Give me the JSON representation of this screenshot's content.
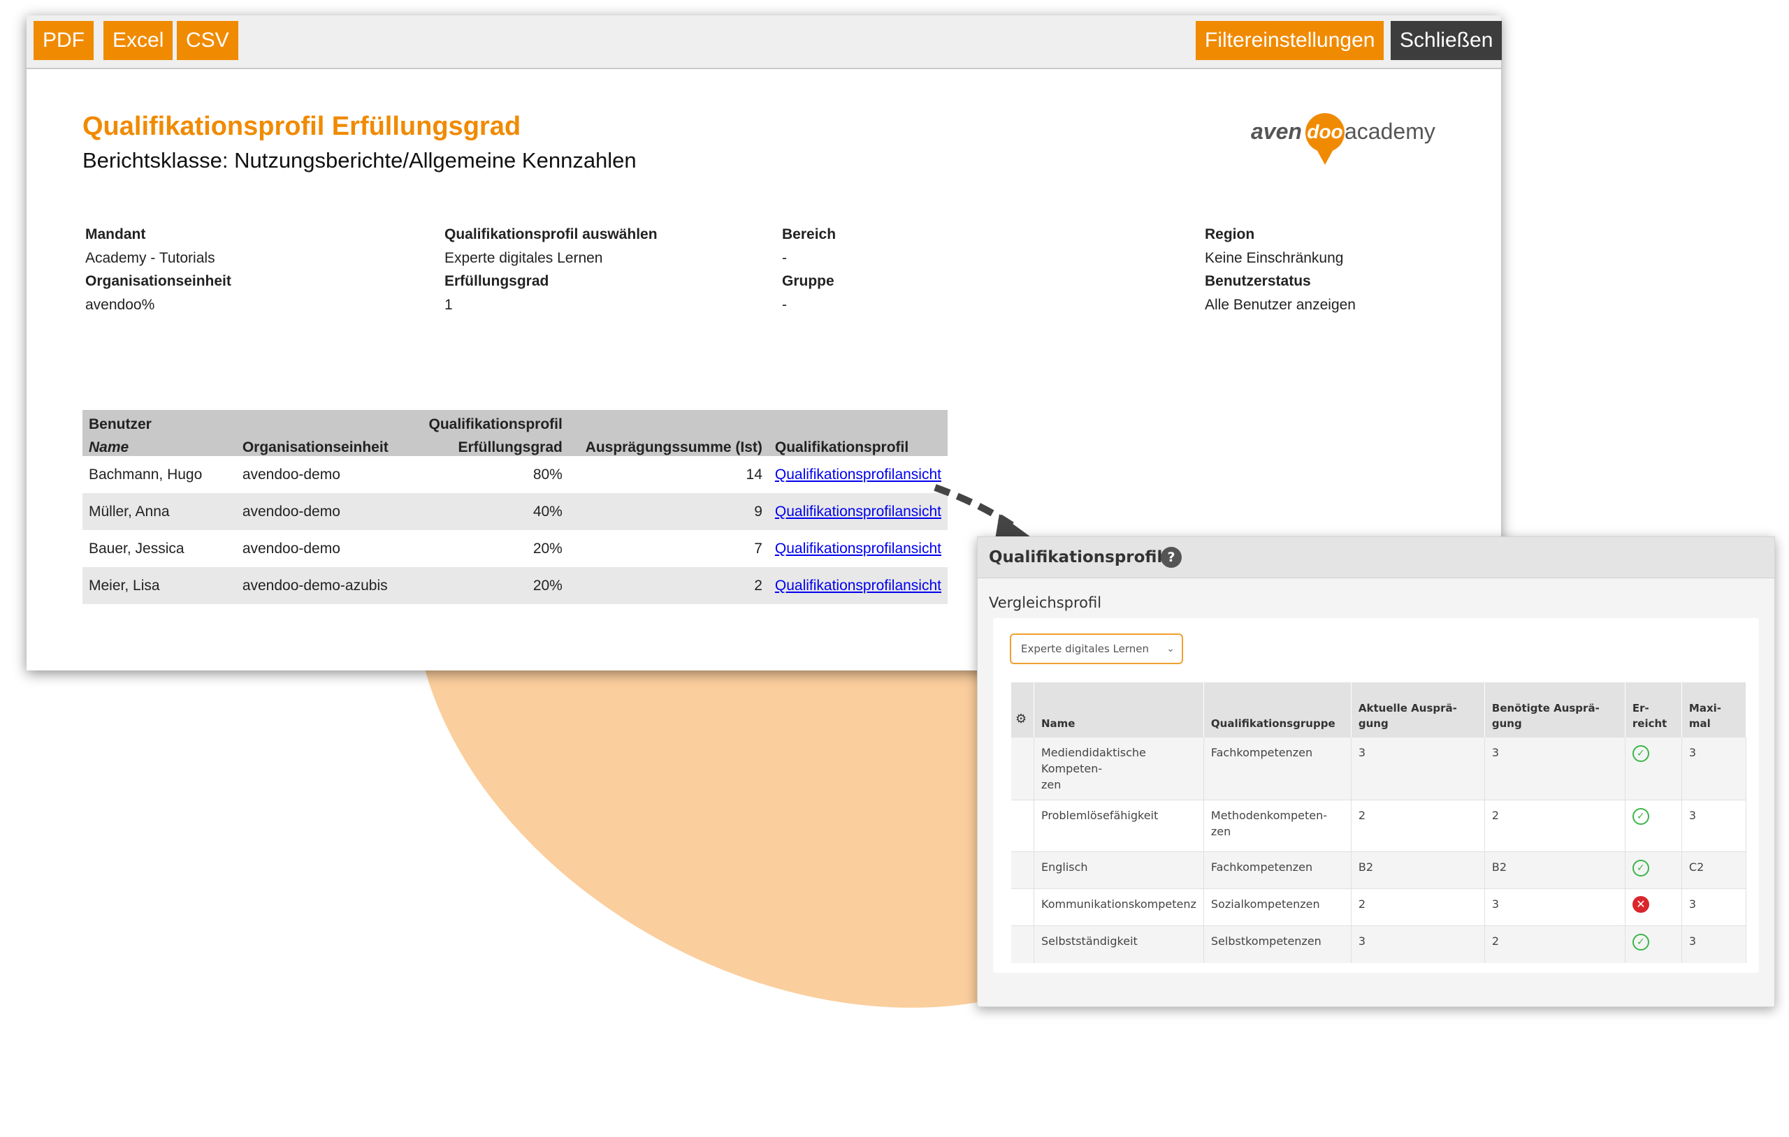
{
  "toolbar": {
    "pdf": "PDF",
    "excel": "Excel",
    "csv": "CSV",
    "filter": "Filtereinstellungen",
    "close": "Schließen"
  },
  "report": {
    "title": "Qualifikationsprofil Erfüllungsgrad",
    "subtitle": "Berichtsklasse: Nutzungsberichte/Allgemeine Kennzahlen",
    "logo": {
      "left": "aven",
      "middle": "doo",
      "right": "academy"
    }
  },
  "filters": {
    "mandant_label": "Mandant",
    "mandant_value": "Academy - Tutorials",
    "orgeinheit_label": "Organisationseinheit",
    "orgeinheit_value": "avendoo%",
    "qprofil_label": "Qualifikationsprofil auswählen",
    "qprofil_value": "Experte digitales Lernen",
    "erfuellung_label": "Erfüllungsgrad",
    "erfuellung_value": "1",
    "bereich_label": "Bereich",
    "bereich_value": "-",
    "gruppe_label": "Gruppe",
    "gruppe_value": "-",
    "region_label": "Region",
    "region_value": "Keine Einschränkung",
    "status_label": "Benutzerstatus",
    "status_value": "Alle Benutzer anzeigen"
  },
  "report_table": {
    "group_benutzer": "Benutzer",
    "group_qprofil": "Qualifikationsprofil",
    "col_name": "Name",
    "col_org": "Organisationseinheit",
    "col_grad": "Erfüllungsgrad",
    "col_summe": "Ausprägungssumme (Ist)",
    "col_profil": "Qualifikationsprofil",
    "rows": [
      {
        "name": "Bachmann, Hugo",
        "org": "avendoo-demo",
        "grad": "80%",
        "summe": "14",
        "link": "Qualifikationsprofilansicht"
      },
      {
        "name": "Müller, Anna",
        "org": "avendoo-demo",
        "grad": "40%",
        "summe": "9",
        "link": "Qualifikationsprofilansicht"
      },
      {
        "name": "Bauer, Jessica",
        "org": "avendoo-demo",
        "grad": "20%",
        "summe": "7",
        "link": "Qualifikationsprofilansicht"
      },
      {
        "name": "Meier, Lisa",
        "org": "avendoo-demo-azubis",
        "grad": "20%",
        "summe": "2",
        "link": "Qualifikationsprofilansicht"
      }
    ]
  },
  "panel": {
    "title": "Qualifikationsprofil",
    "help": "?",
    "vergleich_label": "Vergleichsprofil",
    "select_value": "Experte digitales Lernen",
    "headers": {
      "name": "Name",
      "gruppe": "Qualifikationsgruppe",
      "aktuell_1": "Aktuelle Ausprä-",
      "aktuell_2": "gung",
      "benoetigt_1": "Benötigte Ausprä-",
      "benoetigt_2": "gung",
      "erreicht_1": "Er-",
      "erreicht_2": "reicht",
      "maximal_1": "Maxi-",
      "maximal_2": "mal"
    },
    "rows": [
      {
        "name_1": "Mediendidaktische Kompeten-",
        "name_2": "zen",
        "gruppe_1": "Fachkompetenzen",
        "gruppe_2": "",
        "aktuell": "3",
        "benoetigt": "3",
        "erreicht": true,
        "max": "3"
      },
      {
        "name_1": "Problemlösefähigkeit",
        "name_2": "",
        "gruppe_1": "Methodenkompeten-",
        "gruppe_2": "zen",
        "aktuell": "2",
        "benoetigt": "2",
        "erreicht": true,
        "max": "3"
      },
      {
        "name_1": "Englisch",
        "name_2": "",
        "gruppe_1": "Fachkompetenzen",
        "gruppe_2": "",
        "aktuell": "B2",
        "benoetigt": "B2",
        "erreicht": true,
        "max": "C2"
      },
      {
        "name_1": "Kommunikationskompetenz",
        "name_2": "",
        "gruppe_1": "Sozialkompetenzen",
        "gruppe_2": "",
        "aktuell": "2",
        "benoetigt": "3",
        "erreicht": false,
        "max": "3"
      },
      {
        "name_1": "Selbstständigkeit",
        "name_2": "",
        "gruppe_1": "Selbstkompetenzen",
        "gruppe_2": "",
        "aktuell": "3",
        "benoetigt": "2",
        "erreicht": true,
        "max": "3"
      }
    ]
  },
  "icons": {
    "check": "check-circle-icon",
    "cross": "x-circle-icon",
    "gear": "gear-icon",
    "help": "question-icon",
    "chevron": "chevron-down-icon"
  },
  "colors": {
    "accent": "#f08a00",
    "dark_button": "#3d3d3d",
    "link": "#0000ee",
    "success": "#3cb54a",
    "error": "#d9262c",
    "blob": "#fbc992"
  }
}
